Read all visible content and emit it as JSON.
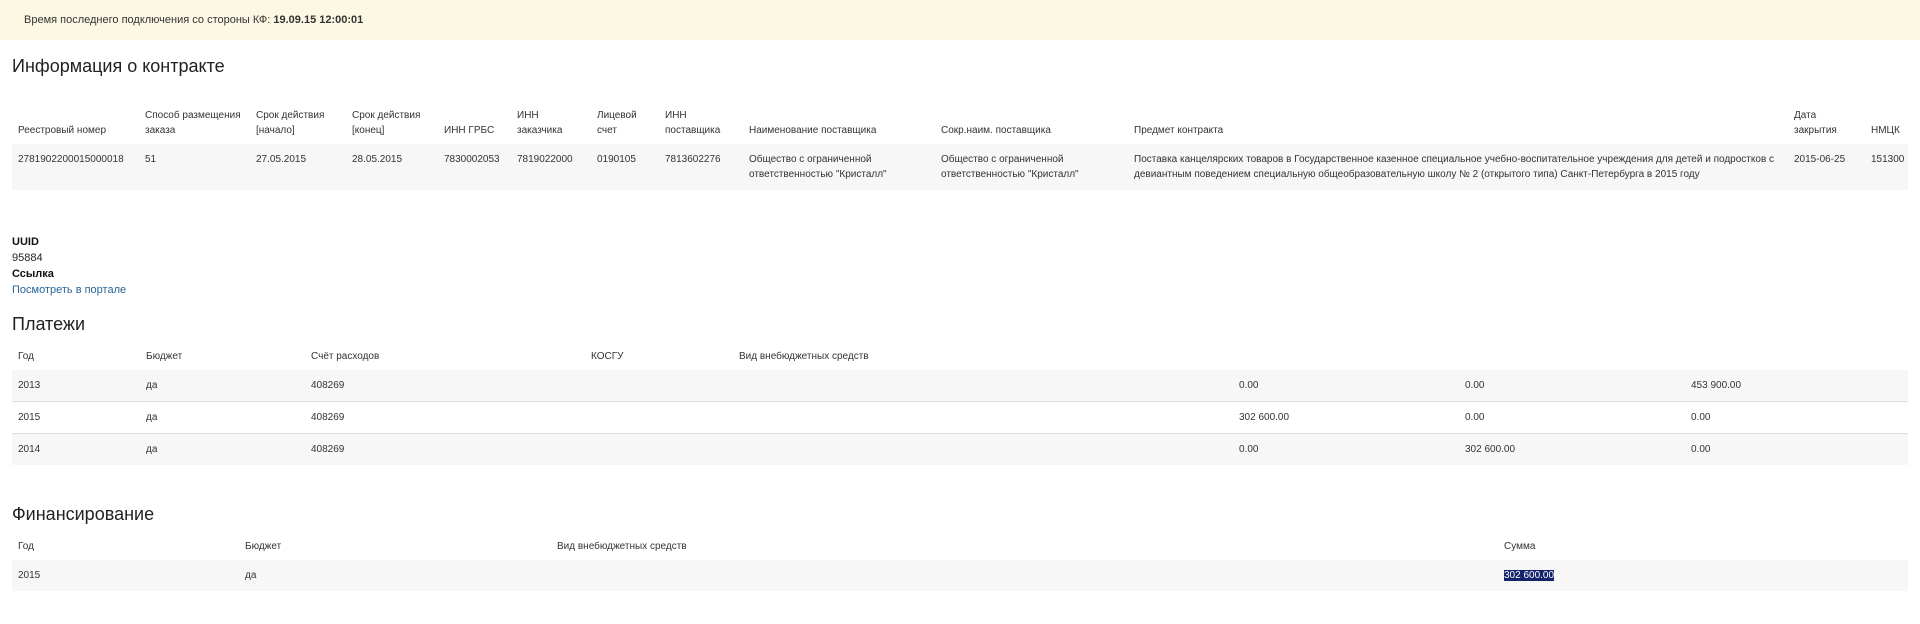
{
  "banner": {
    "prefix": "Время последнего подключения со стороны КФ:",
    "datetime": "19.09.15 12:00:01"
  },
  "contract": {
    "title": "Информация о контракте",
    "headers": [
      "Реестровый номер",
      "Способ размещения заказа",
      "Срок действия [начало]",
      "Срок действия [конец]",
      "ИНН ГРБС",
      "ИНН заказчика",
      "Лицевой счет",
      "ИНН поставщика",
      "Наименование поставщика",
      "Сокр.наим. поставщика",
      "Предмет контракта",
      "Дата закрытия",
      "НМЦК"
    ],
    "row": [
      "2781902200015000018",
      "51",
      "27.05.2015",
      "28.05.2015",
      "7830002053",
      "7819022000",
      "0190105",
      "7813602276",
      "Общество с ограниченной ответственностью \"Кристалл\"",
      "Общество с ограниченной ответственностью \"Кристалл\"",
      "Поставка канцелярских товаров в Государственное казенное специальное учебно-воспитательное учреждения для детей и подростков с девиантным поведением специальную общеобразовательную школу № 2 (открытого типа) Санкт-Петербурга в 2015 году",
      "2015-06-25",
      "151300"
    ]
  },
  "meta": {
    "uuid_label": "UUID",
    "uuid_value": "95884",
    "link_label": "Ссылка",
    "link_text": "Посмотреть в портале"
  },
  "payments": {
    "title": "Платежи",
    "headers": [
      "Год",
      "Бюджет",
      "Счёт расходов",
      "КОСГУ",
      "Вид внебюджетных средств"
    ],
    "rows": [
      [
        "2013",
        "да",
        "408269",
        "",
        "",
        "0.00",
        "0.00",
        "453 900.00"
      ],
      [
        "2015",
        "да",
        "408269",
        "",
        "",
        "302 600.00",
        "0.00",
        "0.00"
      ],
      [
        "2014",
        "да",
        "408269",
        "",
        "",
        "0.00",
        "302 600.00",
        "0.00"
      ]
    ]
  },
  "financing": {
    "title": "Финансирование",
    "headers": [
      "Год",
      "Бюджет",
      "Вид внебюджетных средств",
      "Сумма"
    ],
    "rows": [
      [
        "2015",
        "да",
        "",
        "302 600.00"
      ]
    ]
  }
}
